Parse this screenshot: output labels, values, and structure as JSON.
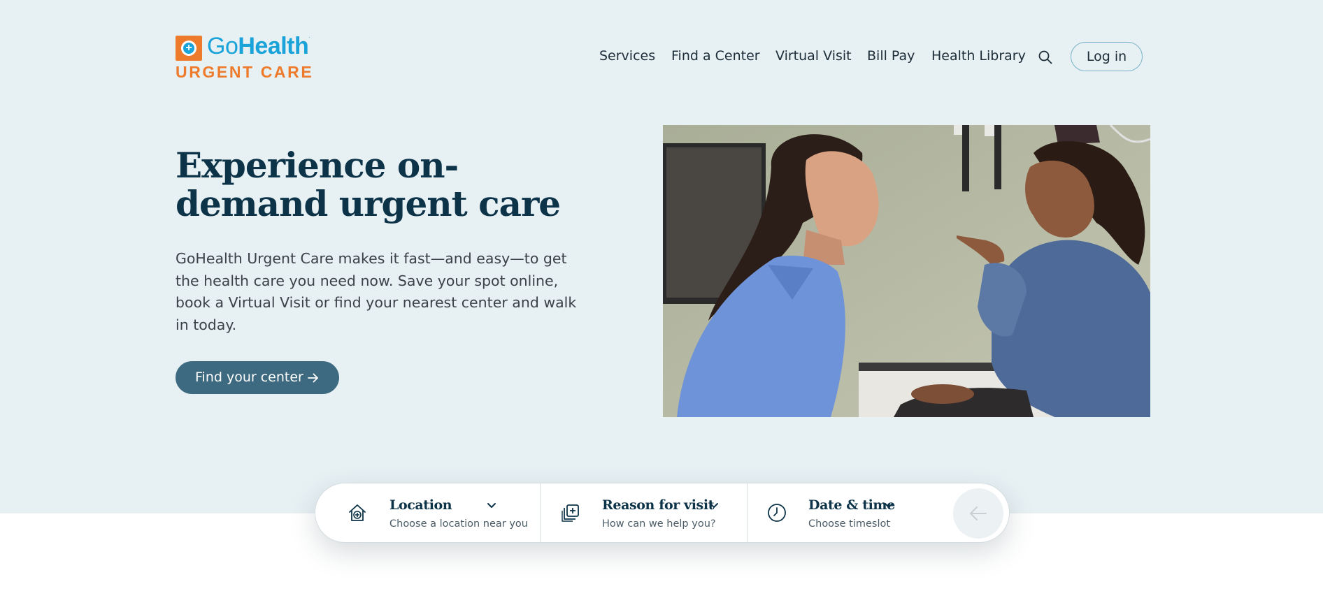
{
  "brand": {
    "logo_prefix": "Go",
    "logo_main": "Health",
    "logo_sub": "URGENT CARE",
    "primary_color": "#1aa3d9",
    "accent_color": "#ee7b2c"
  },
  "nav": {
    "items": [
      "Services",
      "Find a Center",
      "Virtual Visit",
      "Bill Pay",
      "Health Library"
    ],
    "search_icon": "search-icon",
    "login_label": "Log in"
  },
  "hero": {
    "title": "Experience on-demand urgent care",
    "body": "GoHealth Urgent Care makes it fast—and easy—to get the health care you need now. Save your spot online, book a Virtual Visit or find your nearest center and walk in today.",
    "cta_label": "Find your center",
    "cta_color": "#3d6a80"
  },
  "booking": {
    "location": {
      "label": "Location",
      "sub": "Choose a location near you",
      "icon": "home-plus-icon"
    },
    "reason": {
      "label": "Reason for visit",
      "sub": "How can we help you?",
      "icon": "medical-cards-icon"
    },
    "datetime": {
      "label": "Date & time",
      "sub": "Choose timeslot",
      "icon": "clock-icon"
    },
    "submit_icon": "arrow-left-icon"
  }
}
